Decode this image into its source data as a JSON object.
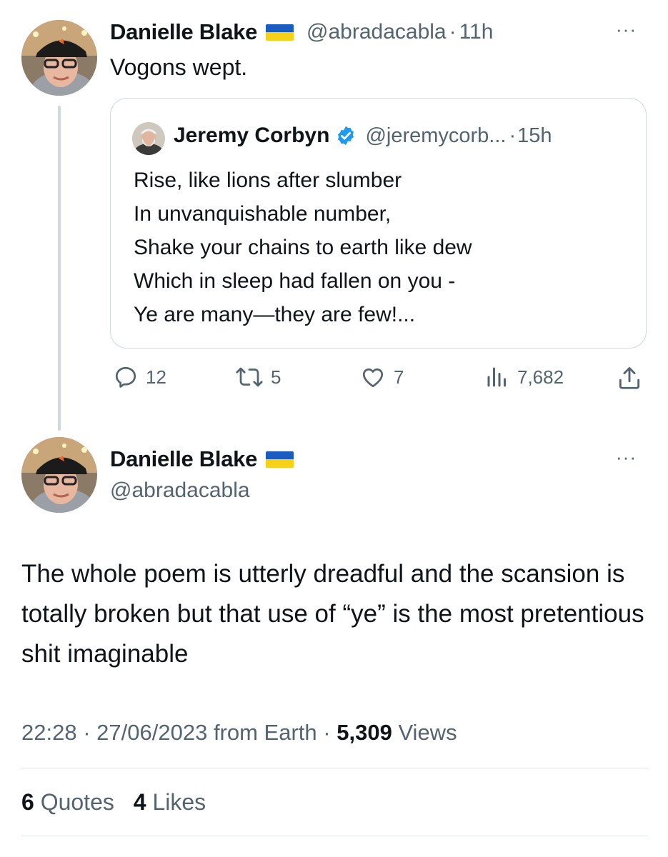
{
  "tweet1": {
    "author_name": "Danielle Blake",
    "handle": "@abradacabla",
    "separator": "·",
    "time": "11h",
    "text": "Vogons wept.",
    "more_label": "···",
    "quoted": {
      "author_name": "Jeremy Corbyn",
      "handle": "@jeremycorb...",
      "separator": "·",
      "time": "15h",
      "lines": [
        "Rise, like lions after slumber",
        "In unvanquishable number,",
        "Shake your chains to earth like dew",
        "Which in sleep had fallen on you -",
        "Ye are many—they are few!..."
      ]
    },
    "actions": {
      "replies": "12",
      "retweets": "5",
      "likes": "7",
      "views": "7,682"
    }
  },
  "tweet2": {
    "author_name": "Danielle Blake",
    "handle": "@abradacabla",
    "more_label": "···",
    "text": "The whole poem is utterly dreadful and the scansion is totally broken but that use of “ye” is the most pretentious shit imaginable",
    "meta": {
      "time": "22:28",
      "sep1": "·",
      "date": "27/06/2023",
      "from": "from Earth",
      "sep2": "·",
      "views_count": "5,309",
      "views_label": "Views"
    },
    "stats": {
      "quotes_count": "6",
      "quotes_label": "Quotes",
      "likes_count": "4",
      "likes_label": "Likes"
    }
  },
  "colors": {
    "text": "#0f1419",
    "secondary": "#536471",
    "border": "#cfd9de",
    "verified": "#1d9bf0",
    "flag_blue": "#1a5cbf",
    "flag_yellow": "#f7d117"
  },
  "icons": {
    "reply": "reply-icon",
    "retweet": "retweet-icon",
    "like": "like-icon",
    "views": "views-icon",
    "share": "share-icon",
    "verified": "verified-badge-icon",
    "flag": "ukraine-flag-icon"
  }
}
